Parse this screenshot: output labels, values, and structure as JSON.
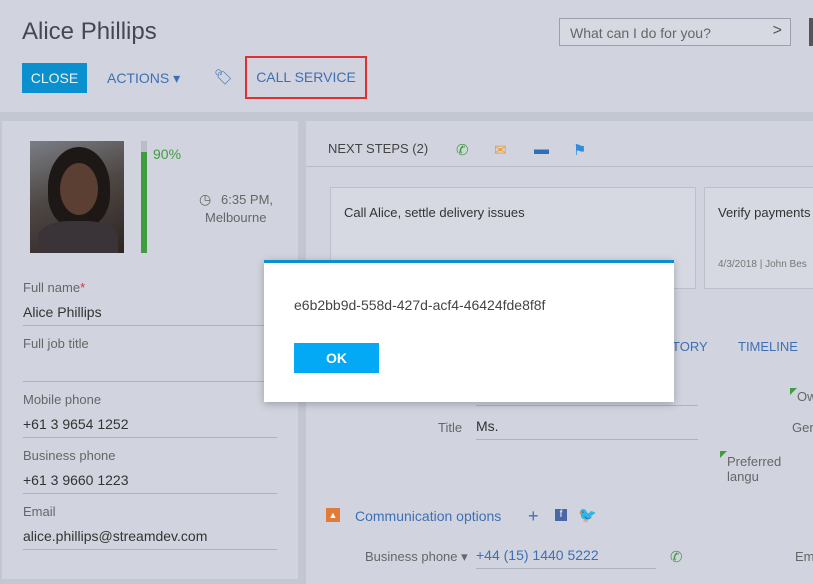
{
  "header": {
    "title": "Alice Phillips",
    "search_placeholder": "What can I do for you?",
    "search_arrow": ">",
    "close_label": "CLOSE",
    "actions_label": "ACTIONS",
    "actions_caret": "▾",
    "tag_icon": "🏷",
    "call_service_label": "CALL SERVICE"
  },
  "profile": {
    "completeness_text": "90%",
    "completeness_value": 0.9,
    "clock_icon": "◷",
    "local_time": "6:35 PM,",
    "city": "Melbourne",
    "fields": [
      {
        "label": "Full name",
        "required_mark": "*",
        "value": "Alice Phillips"
      },
      {
        "label": "Full job title",
        "value": ""
      },
      {
        "label": "Mobile phone",
        "value": "+61 3 9654 1252"
      },
      {
        "label": "Business phone",
        "value": "+61 3 9660 1223"
      },
      {
        "label": "Email",
        "value": "alice.phillips@streamdev.com"
      }
    ]
  },
  "next_steps": {
    "label": "NEXT STEPS (2)",
    "icons": [
      "phone-icon",
      "mail-icon",
      "chat-icon",
      "flag-icon"
    ],
    "cards": [
      {
        "title": "Call Alice, settle delivery issues",
        "meta": ""
      },
      {
        "title": "Verify payments",
        "meta": "4/3/2018 | John Bes"
      }
    ]
  },
  "tabs": [
    {
      "label": "TORY"
    },
    {
      "label": "TIMELINE"
    }
  ],
  "details": {
    "title_label": "Title",
    "title_value": "Ms.",
    "owner_label": "Ow",
    "gender_label": "Gen",
    "preferred_lang_label": "Preferred langu",
    "comm_section_label": "Communication options",
    "comm_plus": "+",
    "comm_fb": "f",
    "comm_tw": "🐦",
    "business_phone_label": "Business phone",
    "business_phone_value": "+44 (15) 1440 5222",
    "em_label": "Em"
  },
  "dialog": {
    "message": "e6b2bb9d-558d-427d-acf4-46424fde8f8f",
    "ok_label": "OK"
  },
  "colors": {
    "accent": "#0a8fcf",
    "ok_button": "#03a9f4",
    "highlight_border": "#e03131",
    "progress": "#3f9d3f"
  }
}
